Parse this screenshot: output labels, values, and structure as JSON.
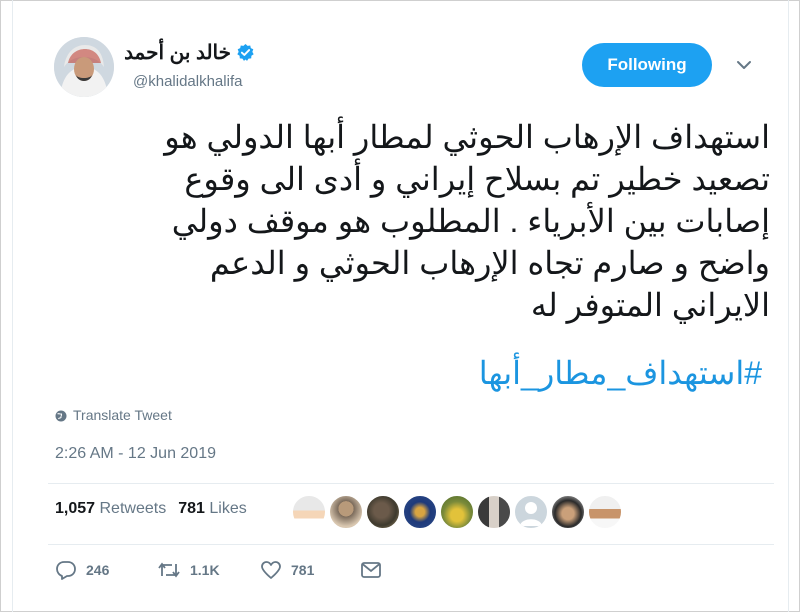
{
  "user": {
    "display_name": "خالد بن أحمد",
    "handle": "@khalidalkhalifa",
    "verified": true
  },
  "follow_button": {
    "label": "Following"
  },
  "tweet": {
    "text": "استهداف الإرهاب الحوثي لمطار أبها الدولي هو\nتصعيد خطير  تم بسلاح إيراني و أدى الى وقوع\nإصابات بين الأبرياء . المطلوب هو موقف دولي\nواضح و صارم تجاه الإرهاب الحوثي و الدعم\nالايراني المتوفر له",
    "hashtag": "#استهداف_مطار_أبها",
    "translate_label": "Translate Tweet",
    "timestamp": "2:26 AM - 12 Jun 2019"
  },
  "stats": {
    "retweets_count": "1,057",
    "retweets_label": "Retweets",
    "likes_count": "781",
    "likes_label": "Likes"
  },
  "actions": {
    "replies": "246",
    "retweets": "1.1K",
    "likes": "781"
  },
  "colors": {
    "accent": "#1da1f2",
    "link": "#1b95e0",
    "muted": "#657786",
    "divider": "#e6ecf0"
  },
  "icons": [
    "verified-badge-icon",
    "chevron-down-icon",
    "globe-icon",
    "reply-icon",
    "retweet-icon",
    "heart-icon",
    "envelope-icon"
  ]
}
